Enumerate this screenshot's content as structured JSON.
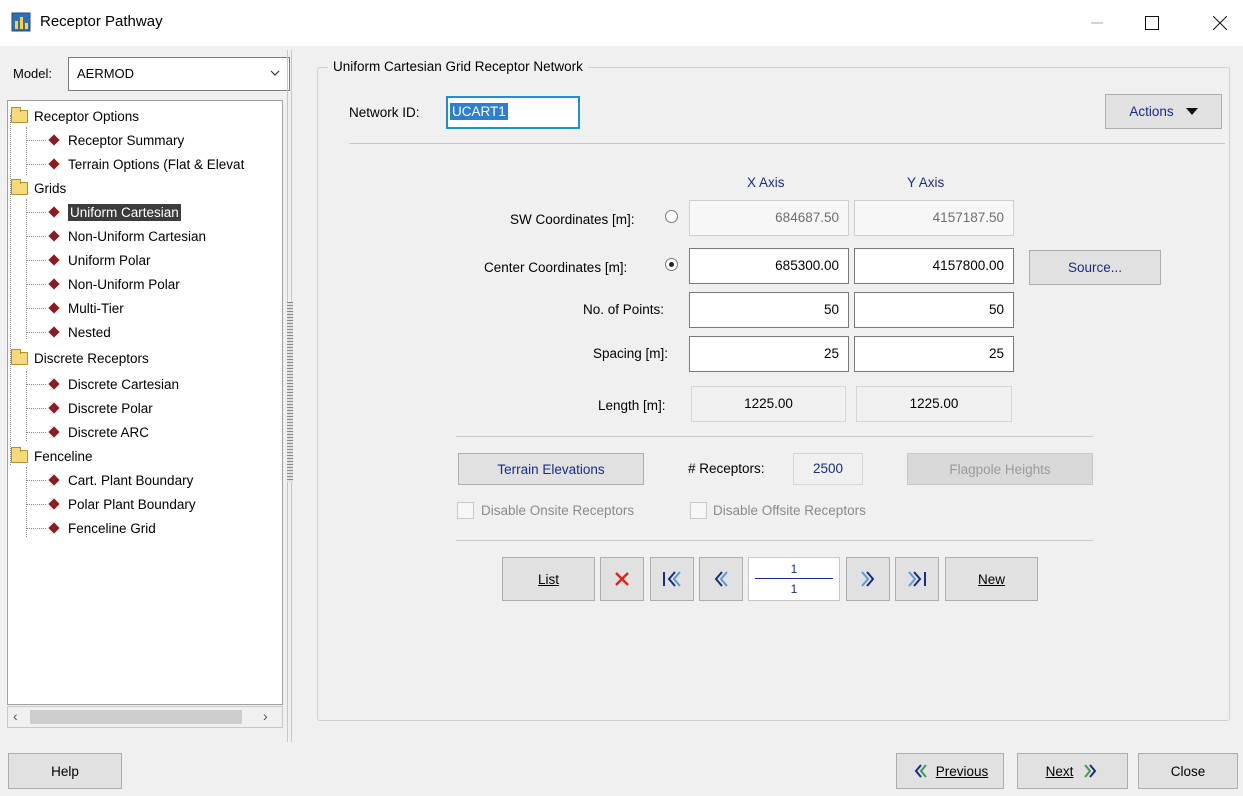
{
  "window": {
    "title": "Receptor Pathway"
  },
  "model": {
    "label": "Model:",
    "value": "AERMOD"
  },
  "tree": {
    "receptor_options": "Receptor Options",
    "receptor_summary": "Receptor Summary",
    "terrain_options": "Terrain Options (Flat & Elevat",
    "grids": "Grids",
    "uniform_cartesian": "Uniform Cartesian",
    "non_uniform_cartesian": "Non-Uniform Cartesian",
    "uniform_polar": "Uniform Polar",
    "non_uniform_polar": "Non-Uniform Polar",
    "multi_tier": "Multi-Tier",
    "nested": "Nested",
    "discrete_receptors": "Discrete Receptors",
    "discrete_cartesian": "Discrete Cartesian",
    "discrete_polar": "Discrete Polar",
    "discrete_arc": "Discrete ARC",
    "fenceline": "Fenceline",
    "cart_plant_boundary": "Cart. Plant Boundary",
    "polar_plant_boundary": "Polar Plant Boundary",
    "fenceline_grid": "Fenceline Grid"
  },
  "panel": {
    "title": "Uniform Cartesian Grid Receptor Network",
    "network_id_label": "Network ID:",
    "network_id": "UCART1",
    "actions": "Actions",
    "x_axis": "X Axis",
    "y_axis": "Y Axis",
    "sw_label": "SW Coordinates [m]:",
    "sw_x": "684687.50",
    "sw_y": "4157187.50",
    "center_label": "Center Coordinates [m]:",
    "center_x": "685300.00",
    "center_y": "4157800.00",
    "source_btn": "Source...",
    "points_label": "No. of Points:",
    "points_x": "50",
    "points_y": "50",
    "spacing_label": "Spacing [m]:",
    "spacing_x": "25",
    "spacing_y": "25",
    "length_label": "Length [m]:",
    "length_x": "1225.00",
    "length_y": "1225.00",
    "terrain_btn": "Terrain Elevations",
    "receptors_label": "# Receptors:",
    "receptors_count": "2500",
    "flagpole_btn": "Flagpole Heights",
    "disable_onsite": "Disable Onsite Receptors",
    "disable_offsite": "Disable Offsite Receptors",
    "list_btn": "List",
    "new_btn": "New",
    "page_current": "1",
    "page_total": "1"
  },
  "footer": {
    "help": "Help",
    "previous": "Previous",
    "next": "Next",
    "close": "Close"
  }
}
